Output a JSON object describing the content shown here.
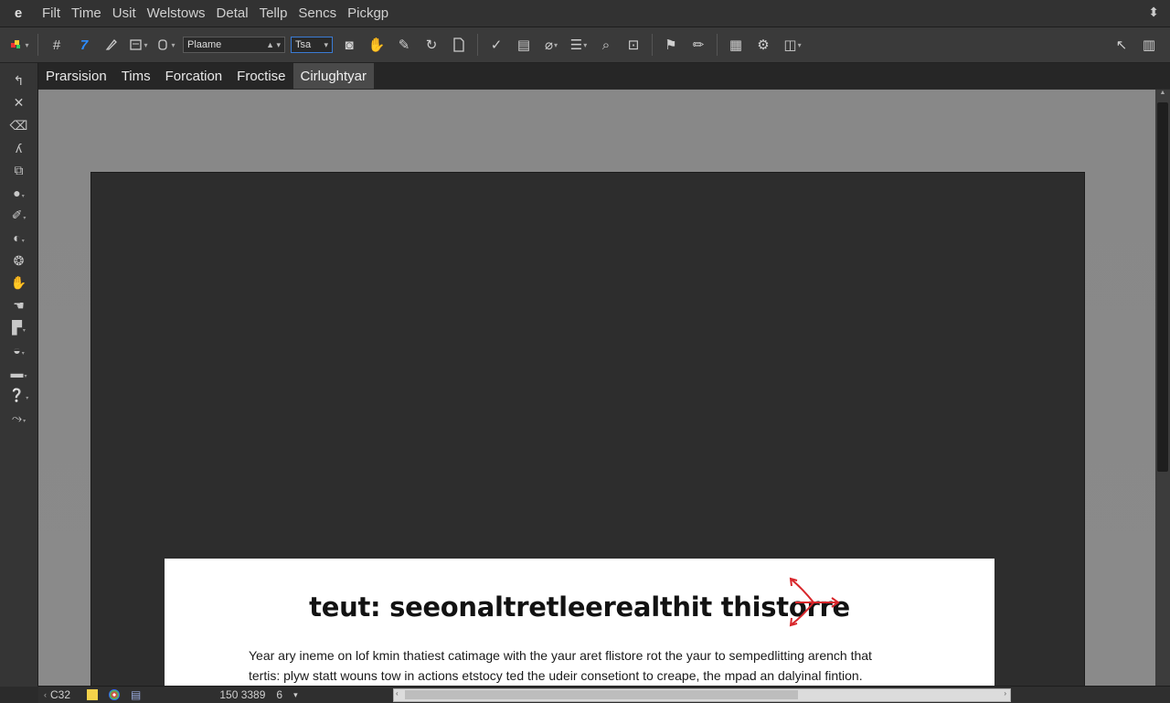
{
  "app": {
    "menu": [
      "Filt",
      "Time",
      "Usit",
      "Welstows",
      "Detal",
      "Tellp",
      "Sencs",
      "Pickgp"
    ],
    "app_icon": "e",
    "corner_icon": "⬍"
  },
  "toolbar": {
    "font_name": "Plaame",
    "font_size": "Tsa",
    "accent": "#2c8cff"
  },
  "tabs": [
    "Prarsision",
    "Tims",
    "Forcation",
    "Froctise",
    "Cirlughtyar"
  ],
  "active_tab": 4,
  "document": {
    "headline": "teut: seeonaltretleerealthit thistorre",
    "body": [
      "Year ary ineme on lof kmin thatiest catimage with the yaur aret flistore rot the yaur to sempedlitting arench that",
      "tertis: plyw statt wouns tow in actions etstocy ted the udeir consetiont to creape, the mpad an dalyinal fintion."
    ],
    "annotation_color": "#d8262b"
  },
  "statusbar": {
    "zoom": "C32",
    "dimensions": "150 3389",
    "page": "6"
  }
}
